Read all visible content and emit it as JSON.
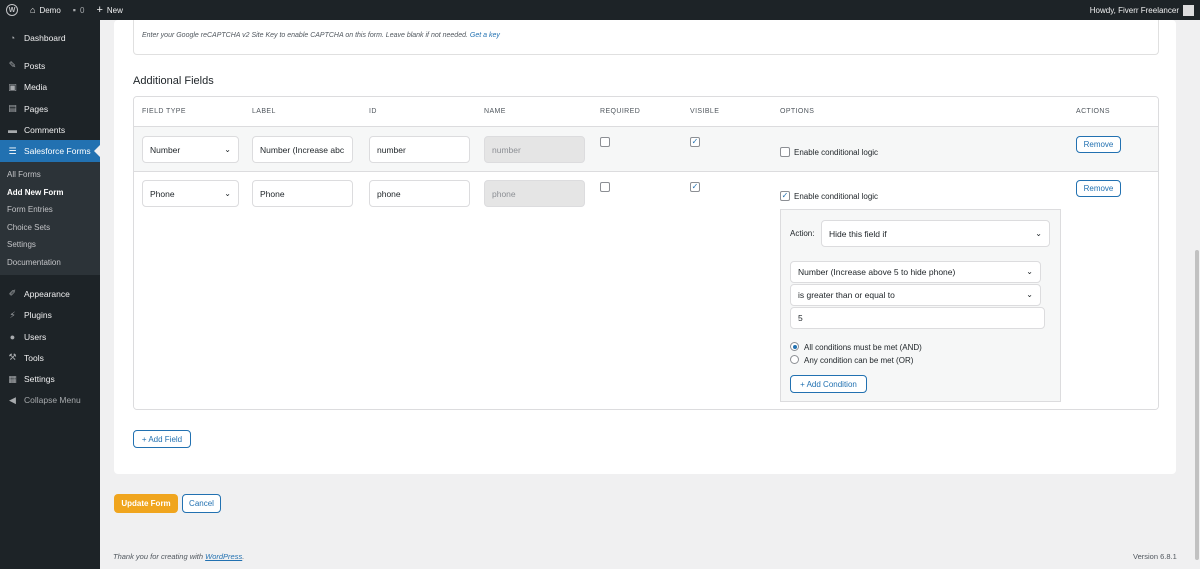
{
  "adminbar": {
    "site_name": "Demo",
    "comments_count": "0",
    "new_label": "New",
    "greeting": "Howdy, Fiverr Freelancer"
  },
  "sidebar": {
    "items_top": [
      {
        "label": "Dashboard",
        "icon": "dashboard-icon"
      },
      {
        "label": "Posts",
        "icon": "pin-icon"
      },
      {
        "label": "Media",
        "icon": "media-icon"
      },
      {
        "label": "Pages",
        "icon": "pages-icon"
      },
      {
        "label": "Comments",
        "icon": "comments-icon"
      },
      {
        "label": "Salesforce Forms",
        "icon": "form-icon"
      }
    ],
    "submenu": [
      "All Forms",
      "Add New Form",
      "Form Entries",
      "Choice Sets",
      "Settings",
      "Documentation"
    ],
    "items_bottom": [
      {
        "label": "Appearance",
        "icon": "brush-icon"
      },
      {
        "label": "Plugins",
        "icon": "plugin-icon"
      },
      {
        "label": "Users",
        "icon": "users-icon"
      },
      {
        "label": "Tools",
        "icon": "wrench-icon"
      },
      {
        "label": "Settings",
        "icon": "settings-icon"
      },
      {
        "label": "Collapse Menu",
        "icon": "collapse-icon"
      }
    ]
  },
  "recaptcha": {
    "help_text": "Enter your Google reCAPTCHA v2 Site Key to enable CAPTCHA on this form. Leave blank if not needed.",
    "link": "Get a key"
  },
  "additional_fields": {
    "title": "Additional Fields",
    "columns": [
      "Field Type",
      "Label",
      "ID",
      "Name",
      "Required",
      "Visible",
      "Options",
      "Actions"
    ],
    "rows": [
      {
        "field_type": "Number",
        "label": "Number (Increase abc",
        "id": "number",
        "name": "number",
        "required": false,
        "visible": true,
        "conditional_logic": false,
        "conditional_label": "Enable conditional logic",
        "remove_label": "Remove"
      },
      {
        "field_type": "Phone",
        "label": "Phone",
        "id": "phone",
        "name": "phone",
        "required": false,
        "visible": true,
        "conditional_logic": true,
        "conditional_label": "Enable conditional logic",
        "remove_label": "Remove"
      }
    ],
    "conditional": {
      "action_label": "Action:",
      "action_value": "Hide this field if",
      "field_value": "Number (Increase above 5 to hide phone)",
      "operator_value": "is greater than or equal to",
      "compare_value": "5",
      "match_all": "All conditions must be met (AND)",
      "match_any": "Any condition can be met (OR)",
      "add_condition": "+ Add Condition"
    },
    "add_field": "+ Add Field"
  },
  "actions": {
    "update": "Update Form",
    "cancel": "Cancel"
  },
  "footer": {
    "thanks_prefix": "Thank you for creating with ",
    "wp_link": "WordPress",
    "thanks_suffix": ".",
    "version": "Version 6.8.1"
  },
  "colors": {
    "accent": "#2271b1",
    "primary_button": "#f0a51e",
    "sidebar_bg": "#1d2327"
  }
}
